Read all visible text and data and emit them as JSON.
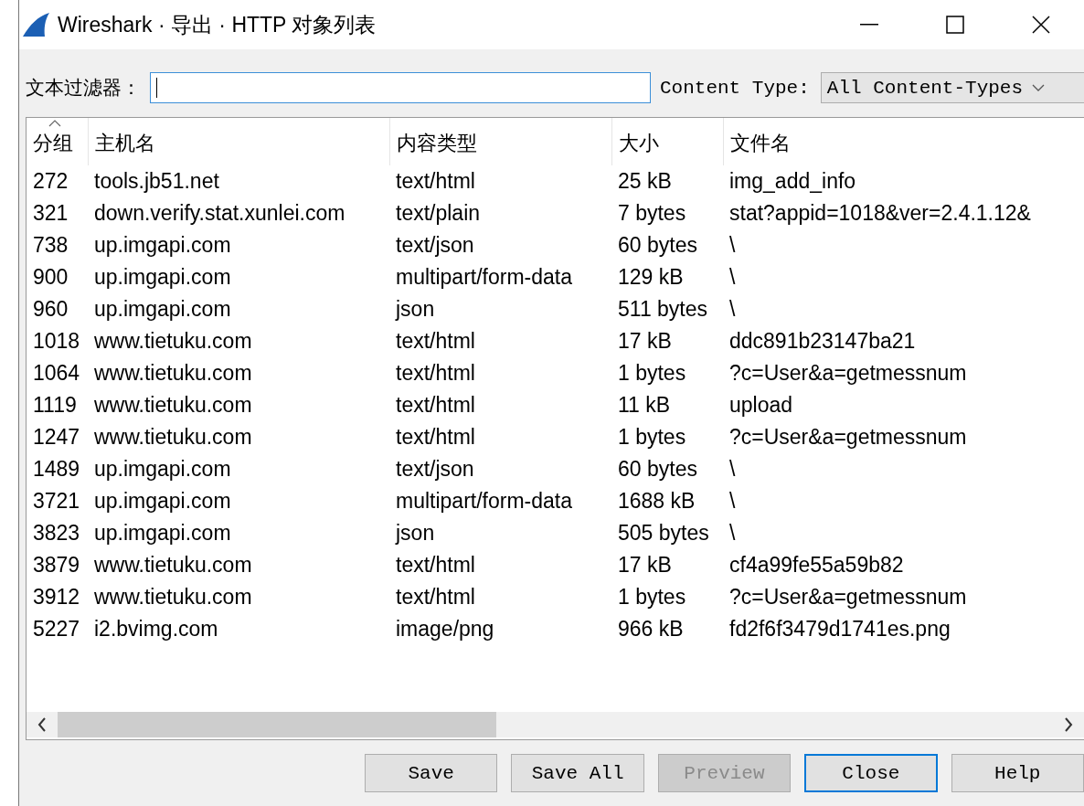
{
  "window": {
    "title": "Wireshark · 导出 · HTTP 对象列表"
  },
  "filter": {
    "label": "文本过滤器：",
    "focused": true
  },
  "content_type": {
    "label": "Content Type:",
    "value": "All Content-Types"
  },
  "table": {
    "columns": [
      {
        "label": "分组",
        "sorted": true
      },
      {
        "label": "主机名",
        "sorted": false
      },
      {
        "label": "内容类型",
        "sorted": false
      },
      {
        "label": "大小",
        "sorted": false
      },
      {
        "label": "文件名",
        "sorted": false
      }
    ],
    "rows": [
      [
        "272",
        "tools.jb51.net",
        "text/html",
        "25 kB",
        "img_add_info"
      ],
      [
        "321",
        "down.verify.stat.xunlei.com",
        "text/plain",
        "7 bytes",
        "stat?appid=1018&ver=2.4.1.12&"
      ],
      [
        "738",
        "up.imgapi.com",
        "text/json",
        "60 bytes",
        "\\"
      ],
      [
        "900",
        "up.imgapi.com",
        "multipart/form-data",
        "129 kB",
        "\\"
      ],
      [
        "960",
        "up.imgapi.com",
        "json",
        "511 bytes",
        "\\"
      ],
      [
        "1018",
        "www.tietuku.com",
        "text/html",
        "17 kB",
        "ddc891b23147ba21"
      ],
      [
        "1064",
        "www.tietuku.com",
        "text/html",
        "1 bytes",
        "?c=User&a=getmessnum"
      ],
      [
        "1119",
        "www.tietuku.com",
        "text/html",
        "11 kB",
        "upload"
      ],
      [
        "1247",
        "www.tietuku.com",
        "text/html",
        "1 bytes",
        "?c=User&a=getmessnum"
      ],
      [
        "1489",
        "up.imgapi.com",
        "text/json",
        "60 bytes",
        "\\"
      ],
      [
        "3721",
        "up.imgapi.com",
        "multipart/form-data",
        "1688 kB",
        "\\"
      ],
      [
        "3823",
        "up.imgapi.com",
        "json",
        "505 bytes",
        "\\"
      ],
      [
        "3879",
        "www.tietuku.com",
        "text/html",
        "17 kB",
        "cf4a99fe55a59b82"
      ],
      [
        "3912",
        "www.tietuku.com",
        "text/html",
        "1 bytes",
        "?c=User&a=getmessnum"
      ],
      [
        "5227",
        "i2.bvimg.com",
        "image/png",
        "966 kB",
        "fd2f6f3479d1741es.png"
      ]
    ]
  },
  "buttons": [
    {
      "label": "Save",
      "disabled": false,
      "focused": false
    },
    {
      "label": "Save All",
      "disabled": false,
      "focused": false
    },
    {
      "label": "Preview",
      "disabled": true,
      "focused": false
    },
    {
      "label": "Close",
      "disabled": false,
      "focused": true
    },
    {
      "label": "Help",
      "disabled": false,
      "focused": false
    }
  ]
}
